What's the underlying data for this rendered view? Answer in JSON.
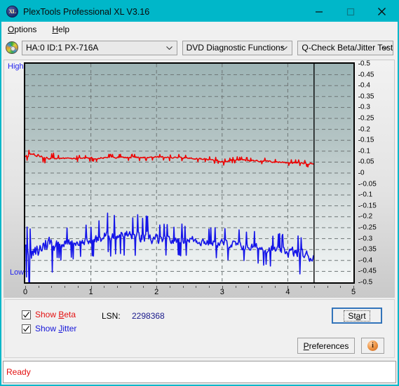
{
  "window": {
    "title": "PlexTools Professional XL V3.16",
    "app_icon": "xl-logo-icon",
    "minimize_label": "minimize-icon",
    "maximize_label": "maximize-icon",
    "close_label": "close-icon",
    "titlebar_color": "#00b7c9"
  },
  "menubar": {
    "items": [
      {
        "label": "Options",
        "accel": "O"
      },
      {
        "label": "Help",
        "accel": "H"
      }
    ]
  },
  "toolbar": {
    "disc_icon": "optical-disc-icon",
    "drive_selector": {
      "value": "HA:0 ID:1  PX-716A",
      "options": [
        "HA:0 ID:1  PX-716A"
      ]
    },
    "function_selector": {
      "value": "DVD Diagnostic Functions",
      "options": [
        "DVD Diagnostic Functions"
      ]
    },
    "test_selector": {
      "value": "Q-Check Beta/Jitter Test",
      "options": [
        "Q-Check Beta/Jitter Test"
      ]
    }
  },
  "chart_labels": {
    "high": "High",
    "low": "Low"
  },
  "chart_data": {
    "type": "line",
    "title": "Q-Check Beta/Jitter Test",
    "xlabel": "",
    "ylabel": "",
    "xlim": [
      0,
      5
    ],
    "ylim": [
      -0.5,
      0.5
    ],
    "xticks": [
      0,
      1,
      2,
      3,
      4,
      5
    ],
    "xtick_labels": [
      "0",
      "1",
      "2",
      "3",
      "4",
      "5"
    ],
    "yticks": [
      0.5,
      0.45,
      0.4,
      0.35,
      0.3,
      0.25,
      0.2,
      0.15,
      0.1,
      0.05,
      0,
      -0.05,
      -0.1,
      -0.15,
      -0.2,
      -0.25,
      -0.3,
      -0.35,
      -0.4,
      -0.45,
      -0.5
    ],
    "ytick_labels": [
      "0.5",
      "0.45",
      "0.4",
      "0.35",
      "0.3",
      "0.25",
      "0.2",
      "0.15",
      "0.1",
      "0.05",
      "0",
      "-0.05",
      "-0.1",
      "-0.15",
      "-0.2",
      "-0.25",
      "-0.3",
      "-0.35",
      "-0.4",
      "-0.45",
      "-0.5"
    ],
    "grid": true,
    "grid_style": "dashed",
    "data_end_x": 4.4,
    "legend_position": "below-chart",
    "series": [
      {
        "name": "Beta",
        "color": "#ee0000",
        "x": [
          0.0,
          0.05,
          0.1,
          0.15,
          0.2,
          0.25,
          0.3,
          0.35,
          0.4,
          0.45,
          0.5,
          0.6,
          0.7,
          0.8,
          0.9,
          1.0,
          1.1,
          1.2,
          1.3,
          1.4,
          1.5,
          1.6,
          1.7,
          1.8,
          1.9,
          2.0,
          2.1,
          2.2,
          2.3,
          2.4,
          2.5,
          2.6,
          2.7,
          2.8,
          2.9,
          3.0,
          3.05,
          3.1,
          3.15,
          3.2,
          3.3,
          3.4,
          3.5,
          3.6,
          3.7,
          3.8,
          3.9,
          4.0,
          4.1,
          4.2,
          4.3,
          4.4
        ],
        "y": [
          0.078,
          0.082,
          0.086,
          0.085,
          0.08,
          0.074,
          0.07,
          0.068,
          0.067,
          0.066,
          0.066,
          0.066,
          0.066,
          0.067,
          0.067,
          0.068,
          0.069,
          0.07,
          0.071,
          0.071,
          0.072,
          0.072,
          0.071,
          0.071,
          0.074,
          0.073,
          0.072,
          0.071,
          0.07,
          0.069,
          0.068,
          0.066,
          0.064,
          0.062,
          0.058,
          0.052,
          0.05,
          0.054,
          0.058,
          0.06,
          0.059,
          0.057,
          0.056,
          0.055,
          0.053,
          0.051,
          0.05,
          0.048,
          0.047,
          0.046,
          0.044,
          0.043
        ],
        "noise_amplitude": 0.006
      },
      {
        "name": "Jitter",
        "color": "#1414e8",
        "x": [
          0.0,
          0.05,
          0.1,
          0.15,
          0.2,
          0.25,
          0.3,
          0.35,
          0.4,
          0.45,
          0.5,
          0.6,
          0.7,
          0.8,
          0.9,
          1.0,
          1.1,
          1.2,
          1.3,
          1.4,
          1.5,
          1.6,
          1.7,
          1.8,
          1.9,
          2.0,
          2.1,
          2.2,
          2.3,
          2.4,
          2.5,
          2.6,
          2.7,
          2.8,
          2.9,
          3.0,
          3.1,
          3.2,
          3.3,
          3.4,
          3.5,
          3.6,
          3.7,
          3.8,
          3.9,
          4.0,
          4.1,
          4.2,
          4.3,
          4.4
        ],
        "y": [
          -0.35,
          -0.368,
          -0.38,
          -0.372,
          -0.36,
          -0.34,
          -0.32,
          -0.318,
          -0.322,
          -0.325,
          -0.322,
          -0.32,
          -0.318,
          -0.318,
          -0.315,
          -0.312,
          -0.305,
          -0.292,
          -0.285,
          -0.28,
          -0.282,
          -0.286,
          -0.292,
          -0.296,
          -0.3,
          -0.305,
          -0.308,
          -0.31,
          -0.308,
          -0.305,
          -0.302,
          -0.306,
          -0.312,
          -0.316,
          -0.32,
          -0.322,
          -0.325,
          -0.33,
          -0.334,
          -0.338,
          -0.34,
          -0.344,
          -0.348,
          -0.352,
          -0.356,
          -0.36,
          -0.366,
          -0.372,
          -0.38,
          -0.386
        ],
        "noise_amplitude": 0.03
      }
    ]
  },
  "controls": {
    "show_beta": {
      "label_pre": "Show ",
      "accel": "B",
      "label_post": "eta",
      "checked": true
    },
    "show_jitter": {
      "label_pre": "Show ",
      "accel": "J",
      "label_post": "itter",
      "checked": true
    },
    "lsn_label": "LSN:",
    "lsn_value": "2298368",
    "start_button": {
      "label_pre": "St",
      "accel": "a",
      "label_post": "rt"
    },
    "preferences_button": {
      "accel": "P",
      "label_post": "references"
    },
    "info_button": "info-icon"
  },
  "statusbar": {
    "text": "Ready",
    "color": "#e31010"
  }
}
